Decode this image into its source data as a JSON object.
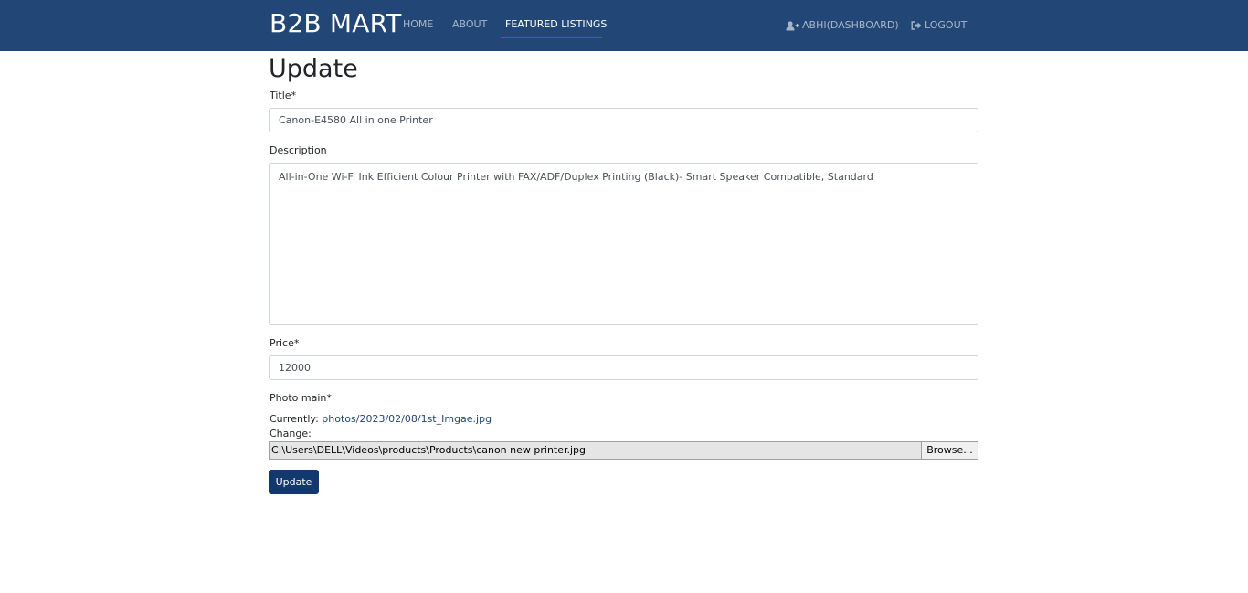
{
  "navbar": {
    "brand": "B2B MART",
    "links": [
      "HOME",
      "ABOUT",
      "FEATURED LISTINGS"
    ],
    "active_link": "FEATURED LISTINGS",
    "dashboard": "ABHI(DASHBOARD)",
    "dashboard_icon": "user-plus-icon",
    "logout": "LOGOUT",
    "logout_icon": "sign-out-icon",
    "colors": {
      "background": "#224675",
      "active_underline": "#d9263a"
    }
  },
  "form": {
    "heading": "Update",
    "title_label": "Title*",
    "title_value": "Canon-E4580 All in one Printer",
    "description_label": "Description",
    "description_value": "All-in-One Wi-Fi Ink Efficient Colour Printer with FAX/ADF/Duplex Printing (Black)- Smart Speaker Compatible, Standard",
    "price_label": "Price*",
    "price_value": "12000",
    "photo_label": "Photo main*",
    "currently_label": "Currently:",
    "currently_link": "photos/2023/02/08/1st_Imgae.jpg",
    "change_label": "Change:",
    "file_path": "C:\\Users\\DELL\\Videos\\products\\Products\\canon new printer.jpg",
    "browse_label": "Browse...",
    "submit_label": "Update",
    "colors": {
      "submit": "#12386e"
    }
  }
}
